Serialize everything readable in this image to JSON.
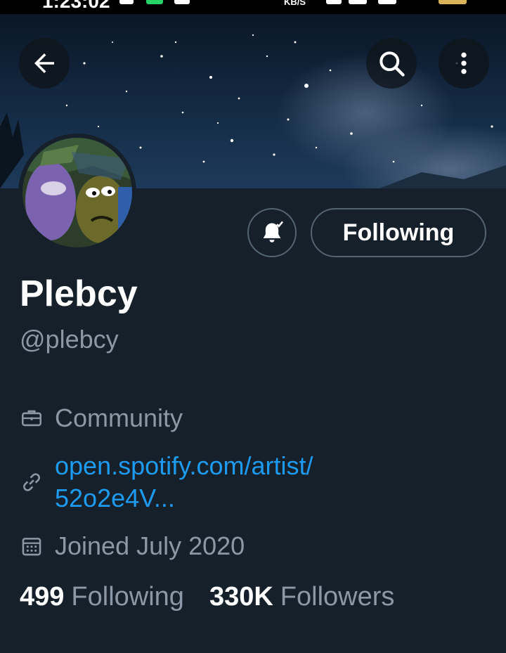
{
  "status_bar": {
    "time": "1:23:02",
    "net_speed": "KB/S"
  },
  "header": {
    "back_icon": "arrow-left-icon",
    "search_icon": "search-icon",
    "more_icon": "more-vertical-icon"
  },
  "profile": {
    "display_name": "Plebcy",
    "handle": "@plebcy",
    "notify_icon": "bell-check-icon",
    "follow_button_label": "Following",
    "category": "Community",
    "link_text_line1": "open.spotify.com/artist/",
    "link_text_line2": "52o2e4V...",
    "joined": "Joined July 2020"
  },
  "stats": {
    "following_count": "499",
    "following_label": "Following",
    "followers_count": "330K",
    "followers_label": "Followers"
  },
  "colors": {
    "background": "#15202b",
    "secondary_text": "#8b98a5",
    "link": "#1d9bf0",
    "border": "#536471"
  }
}
